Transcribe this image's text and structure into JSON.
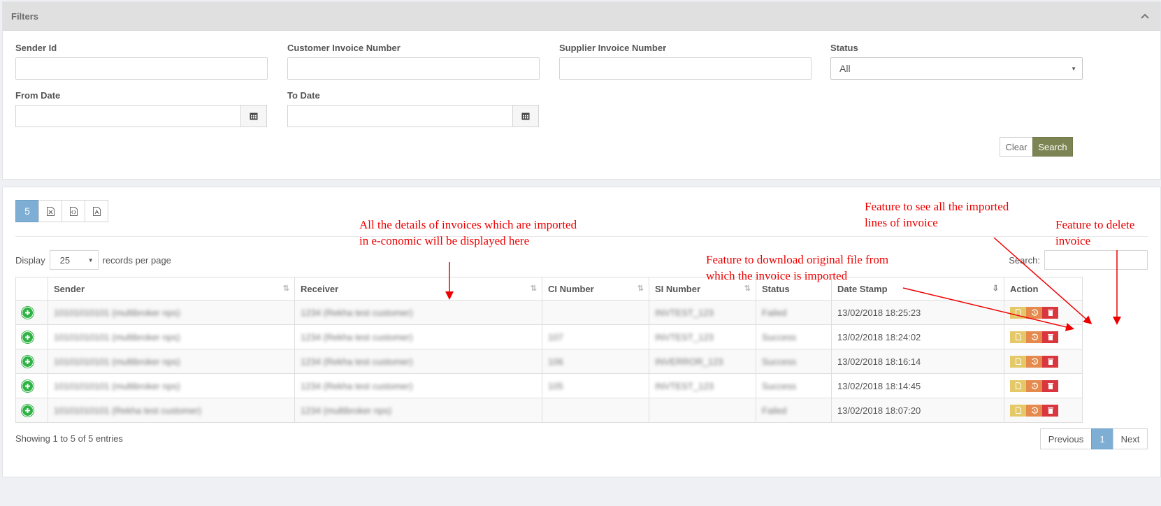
{
  "filters": {
    "header": "Filters",
    "sender_id_label": "Sender Id",
    "customer_invoice_label": "Customer Invoice Number",
    "supplier_invoice_label": "Supplier Invoice Number",
    "status_label": "Status",
    "status_value": "All",
    "from_date_label": "From Date",
    "to_date_label": "To Date",
    "clear_label": "Clear",
    "search_label": "Search"
  },
  "toolbar": {
    "count_badge": "5",
    "export_icons": [
      "excel-icon",
      "csv-icon",
      "pdf-icon"
    ]
  },
  "table_controls": {
    "display_label": "Display",
    "page_size": "25",
    "records_label": "records per page",
    "search_label": "Search:"
  },
  "columns": [
    "Sender",
    "Receiver",
    "CI Number",
    "SI Number",
    "Status",
    "Date Stamp",
    "Action"
  ],
  "rows": [
    {
      "sender": "10101010101 (multibroker nps)",
      "receiver": "1234 (Rekha test customer)",
      "ci": "",
      "si": "INVTEST_123",
      "status": "Failed",
      "date": "13/02/2018 18:25:23"
    },
    {
      "sender": "10101010101 (multibroker nps)",
      "receiver": "1234 (Rekha test customer)",
      "ci": "107",
      "si": "INVTEST_123",
      "status": "Success",
      "date": "13/02/2018 18:24:02"
    },
    {
      "sender": "10101010101 (multibroker nps)",
      "receiver": "1234 (Rekha test customer)",
      "ci": "106",
      "si": "INVERROR_123",
      "status": "Success",
      "date": "13/02/2018 18:16:14"
    },
    {
      "sender": "10101010101 (multibroker nps)",
      "receiver": "1234 (Rekha test customer)",
      "ci": "105",
      "si": "INVTEST_123",
      "status": "Success",
      "date": "13/02/2018 18:14:45"
    },
    {
      "sender": "10101010101 (Rekha test customer)",
      "receiver": "1234 (multibroker nps)",
      "ci": "",
      "si": "",
      "status": "Failed",
      "date": "13/02/2018 18:07:20"
    }
  ],
  "footer": {
    "info": "Showing 1 to 5 of 5 entries",
    "prev": "Previous",
    "page": "1",
    "next": "Next"
  },
  "annotations": {
    "details": "All the details of invoices which are imported\nin e-conomic will be displayed here",
    "download": "Feature to download original file from\nwhich the invoice is imported",
    "lines": "Feature to see all the imported\nlines of invoice",
    "delete": "Feature to delete\ninvoice",
    "color": "#e00000"
  },
  "colors": {
    "search_button": "#7d8453",
    "active_page": "#7eaed3",
    "download_action": "#e5c867",
    "lines_action": "#e58a4c",
    "delete_action": "#d9363e",
    "expand": "#2fb344"
  }
}
